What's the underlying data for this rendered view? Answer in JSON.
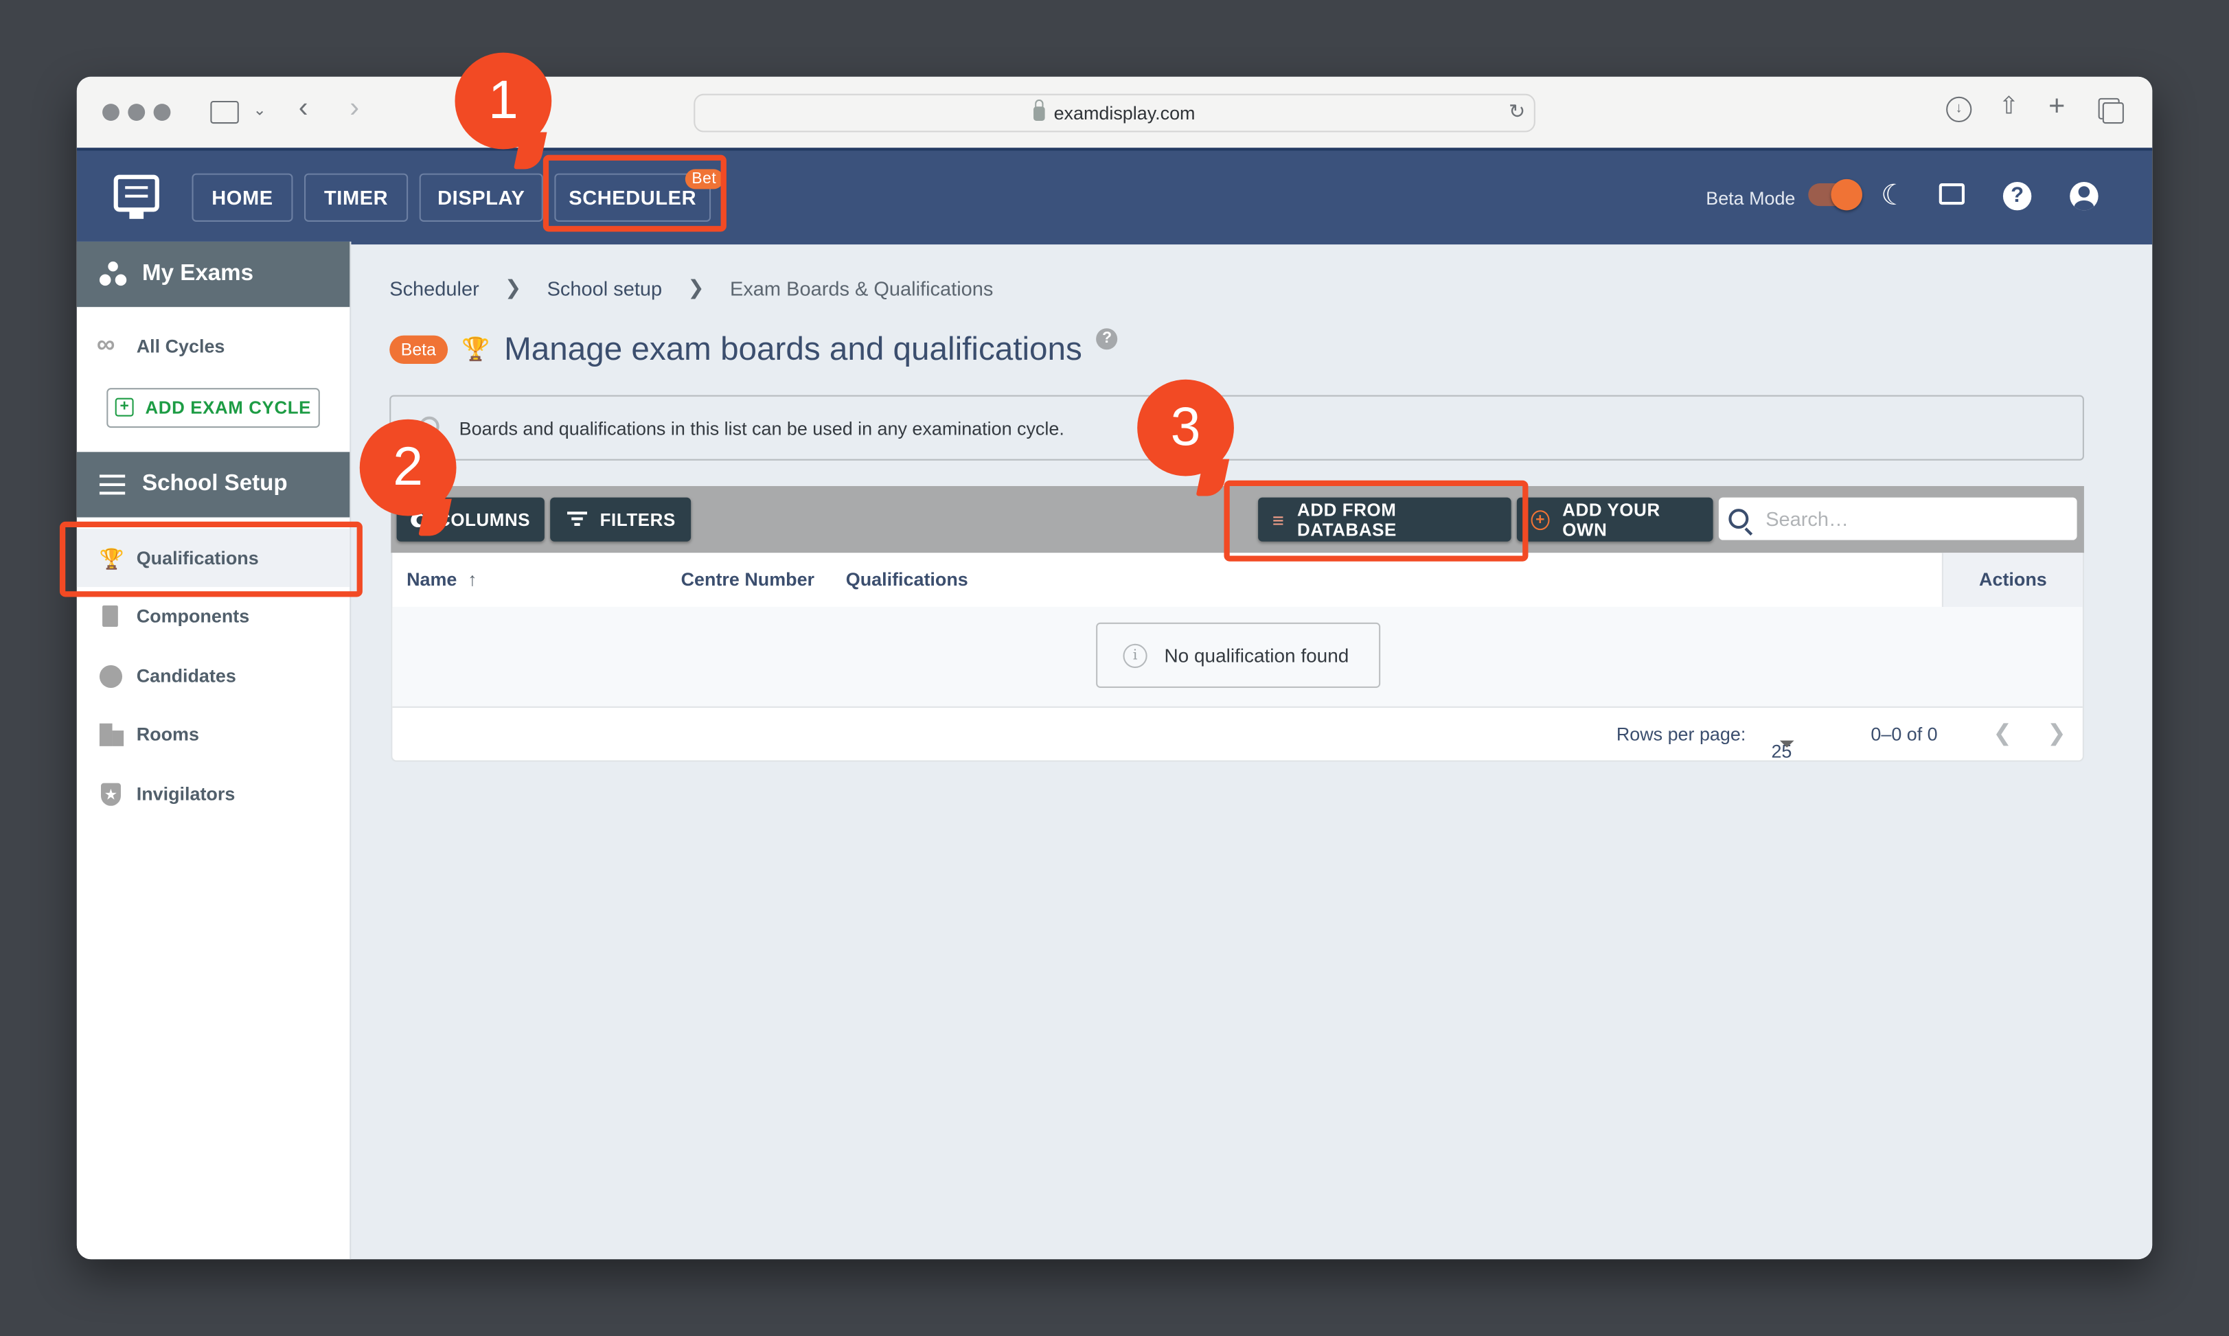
{
  "browser": {
    "url": "examdisplay.com",
    "icons": [
      "sidebar-toggle-icon",
      "chevron-down-icon",
      "back-icon",
      "forward-icon",
      "lock-icon",
      "reload-icon",
      "download-icon",
      "share-icon",
      "new-tab-icon",
      "tab-overview-icon"
    ]
  },
  "header": {
    "nav": [
      {
        "label": "HOME"
      },
      {
        "label": "TIMER"
      },
      {
        "label": "DISPLAY"
      },
      {
        "label": "SCHEDULER",
        "badge": "Bet"
      }
    ],
    "beta_mode_label": "Beta Mode",
    "beta_mode_on": true,
    "icons": [
      "dark-mode-icon",
      "display-icon",
      "help-icon",
      "account-icon"
    ]
  },
  "sidebar": {
    "my_exams": {
      "title": "My Exams",
      "items": [
        {
          "label": "All Cycles"
        }
      ],
      "add_button": "ADD EXAM CYCLE"
    },
    "school_setup": {
      "title": "School Setup",
      "items": [
        {
          "label": "Qualifications",
          "active": true
        },
        {
          "label": "Components"
        },
        {
          "label": "Candidates"
        },
        {
          "label": "Rooms"
        },
        {
          "label": "Invigilators"
        }
      ]
    }
  },
  "main": {
    "breadcrumb": [
      "Scheduler",
      "School setup",
      "Exam Boards & Qualifications"
    ],
    "beta_badge": "Beta",
    "title": "Manage exam boards and qualifications",
    "help": "?",
    "info": "Boards and qualifications in this list can be used in any examination cycle.",
    "toolbar": {
      "columns": "COLUMNS",
      "filters": "FILTERS",
      "add_from_db": "ADD FROM DATABASE",
      "add_your_own": "ADD YOUR OWN",
      "search_placeholder": "Search…"
    },
    "table": {
      "columns": [
        "Name",
        "Centre Number",
        "Qualifications",
        "Actions"
      ],
      "sort": "Name ascending",
      "rows": [],
      "empty_message": "No qualification found",
      "rows_per_page_label": "Rows per page:",
      "rows_per_page": "25",
      "range": "0–0 of 0"
    }
  },
  "annotations": {
    "steps": [
      "1",
      "2",
      "3"
    ],
    "color": "#f24a24"
  },
  "colors": {
    "header": "#3b527c",
    "accent": "#f07335",
    "sidebar_head": "#5f6e77",
    "toolbar_button": "#2d3f49",
    "add_green": "#1d9c44"
  }
}
